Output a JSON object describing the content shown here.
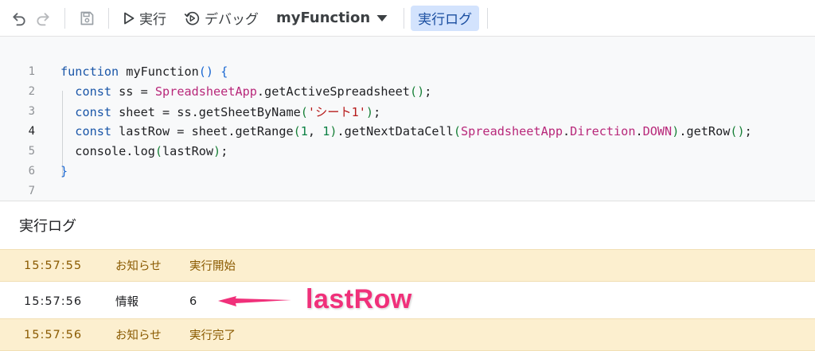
{
  "toolbar": {
    "undo_icon": "undo-icon",
    "redo_icon": "redo-icon",
    "save_icon": "save-icon",
    "run_label": "実行",
    "debug_label": "デバッグ",
    "function_select": "myFunction",
    "log_label": "実行ログ"
  },
  "editor": {
    "active_line": "4",
    "lines": [
      {
        "num": "1",
        "code": "function myFunction() {"
      },
      {
        "num": "2",
        "code": "  const ss = SpreadsheetApp.getActiveSpreadsheet();"
      },
      {
        "num": "3",
        "code": "  const sheet = ss.getSheetByName('シート1');"
      },
      {
        "num": "4",
        "code": "  const lastRow = sheet.getRange(1, 1).getNextDataCell(SpreadsheetApp.Direction.DOWN).getRow();"
      },
      {
        "num": "5",
        "code": "  console.log(lastRow);"
      },
      {
        "num": "6",
        "code": "}"
      },
      {
        "num": "7",
        "code": ""
      }
    ]
  },
  "log": {
    "title": "実行ログ",
    "rows": [
      {
        "time": "15:57:55",
        "type": "お知らせ",
        "message": "実行開始"
      },
      {
        "time": "15:57:56",
        "type": "情報",
        "message": "6"
      },
      {
        "time": "15:57:56",
        "type": "お知らせ",
        "message": "実行完了"
      }
    ]
  },
  "annotation": {
    "label": "lastRow",
    "color": "#f0307a"
  },
  "colors": {
    "notice_bg": "#fcefcf",
    "selected_tab_bg": "#d3e3fd"
  }
}
